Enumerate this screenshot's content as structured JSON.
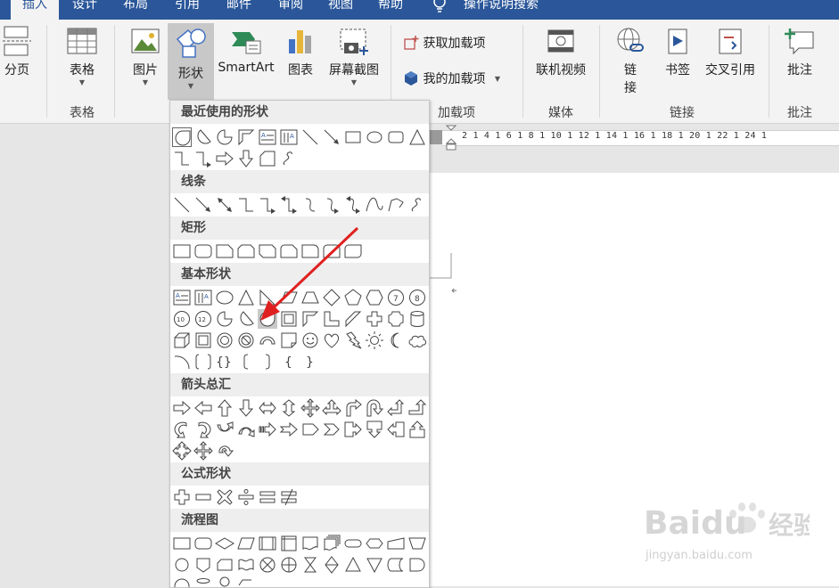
{
  "tabs": [
    {
      "label": "插入",
      "active": true
    },
    {
      "label": "设计"
    },
    {
      "label": "布局"
    },
    {
      "label": "引用"
    },
    {
      "label": "邮件"
    },
    {
      "label": "审阅"
    },
    {
      "label": "视图"
    },
    {
      "label": "帮助"
    }
  ],
  "tell_me": "操作说明搜索",
  "ribbon": {
    "page_break": "分页",
    "table": "表格",
    "picture": "图片",
    "shapes": "形状",
    "smartart": "SmartArt",
    "chart": "图表",
    "screenshot": "屏幕截图",
    "get_addins": "获取加载项",
    "my_addins": "我的加载项",
    "online_video": "联机视频",
    "link_1": "链",
    "link_2": "接",
    "bookmark": "书签",
    "crossref": "交叉引用",
    "comment": "批注",
    "groups": {
      "tables": "表格",
      "addins": "加载项",
      "media": "媒体",
      "links": "链接",
      "comments": "批注"
    }
  },
  "ruler_text": "2 1 4 1 6 1 8 1 10 1 12 1 14 1 16 1 18 1 20 1 22 1 24 1",
  "dropdown": {
    "sections": [
      {
        "label": "最近使用的形状"
      },
      {
        "label": "线条"
      },
      {
        "label": "矩形"
      },
      {
        "label": "基本形状"
      },
      {
        "label": "箭头总汇"
      },
      {
        "label": "公式形状"
      },
      {
        "label": "流程图"
      }
    ],
    "selected_shape": "oval"
  },
  "watermark": {
    "brand": "Baidu",
    "cn": "经验",
    "url": "jingyan.baidu.com"
  },
  "colors": {
    "accent": "#2b579a",
    "arrow": "#e02020"
  }
}
